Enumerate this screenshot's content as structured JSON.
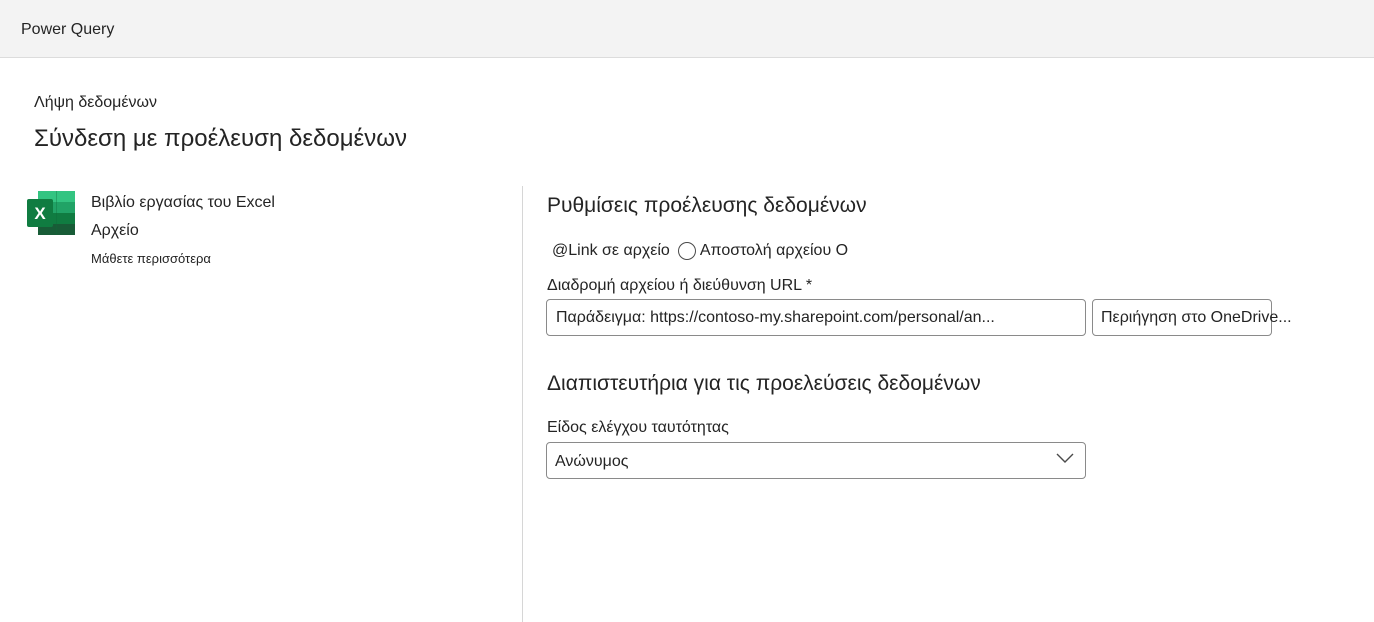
{
  "app": {
    "title": "Power Query"
  },
  "header": {
    "breadcrumb": "Λήψη δεδομένων",
    "title": "Σύνδεση με προέλευση δεδομένων"
  },
  "connector": {
    "icon": "excel-icon",
    "name": "Βιβλίο εργασίας του Excel",
    "category": "Αρχείο",
    "learn_more": "Μάθετε περισσότερα",
    "brand_color": "#107c41"
  },
  "settings": {
    "title": "Ρυθμίσεις προέλευσης δεδομένων",
    "source_options": [
      {
        "label": "@Link σε αρχείο",
        "selected": false
      },
      {
        "label": "Αποστολή αρχείου O",
        "selected": false
      }
    ],
    "path_label": "Διαδρομή αρχείου ή διεύθυνση URL *",
    "path_placeholder": "Παράδειγμα: https://contoso-my.sharepoint.com/personal/an...",
    "path_value": "",
    "browse_label": "Περιήγηση στο OneDrive..."
  },
  "credentials": {
    "title": "Διαπιστευτήρια για τις προελεύσεις δεδομένων",
    "auth_label": "Είδος ελέγχου ταυτότητας",
    "auth_value": "Ανώνυμος",
    "chevron_icon": "chevron-down-icon"
  }
}
